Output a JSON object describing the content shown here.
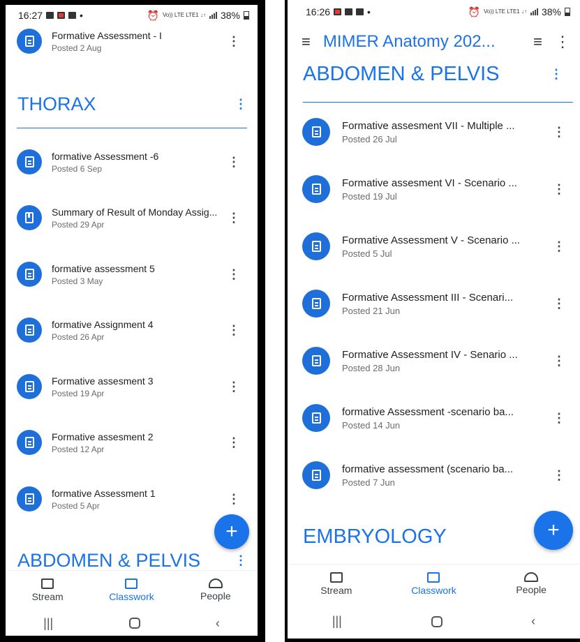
{
  "left_phone": {
    "status": {
      "time": "16:27",
      "battery": "38%",
      "network": "Vo)) LTE LTE1 ↓↑"
    },
    "partial_item": {
      "title": "Formative Assessment - I",
      "posted": "Posted 2 Aug"
    },
    "sections": [
      {
        "title": "THORAX"
      },
      {
        "title": "ABDOMEN & PELVIS"
      }
    ],
    "items": [
      {
        "title": "formative Assessment -6",
        "posted": "Posted 6 Sep",
        "icon": "assignment-icon"
      },
      {
        "title": "Summary of Result of Monday Assig...",
        "posted": "Posted 29 Apr",
        "icon": "material-icon"
      },
      {
        "title": "formative assessment  5",
        "posted": "Posted 3 May",
        "icon": "assignment-icon"
      },
      {
        "title": "formative Assignment 4",
        "posted": "Posted 26 Apr",
        "icon": "assignment-icon"
      },
      {
        "title": "Formative assesment 3",
        "posted": "Posted 19 Apr",
        "icon": "assignment-icon"
      },
      {
        "title": "Formative assesment 2",
        "posted": "Posted 12 Apr",
        "icon": "assignment-icon"
      },
      {
        "title": "formative Assessment 1",
        "posted": "Posted 5 Apr",
        "icon": "assignment-icon"
      }
    ],
    "nav": {
      "stream": "Stream",
      "classwork": "Classwork",
      "people": "People"
    },
    "fab": "+"
  },
  "right_phone": {
    "status": {
      "time": "16:26",
      "battery": "38%",
      "network": "Vo)) LTE LTE1 ↓↑"
    },
    "appbar": {
      "title": "MIMER Anatomy 202..."
    },
    "sections": [
      {
        "title": "ABDOMEN & PELVIS"
      },
      {
        "title": "EMBRYOLOGY"
      }
    ],
    "items": [
      {
        "title": "Formative assesment VII - Multiple ...",
        "posted": "Posted 26 Jul",
        "icon": "assignment-icon"
      },
      {
        "title": "Formative assesment VI - Scenario ...",
        "posted": "Posted 19 Jul",
        "icon": "assignment-icon"
      },
      {
        "title": "Formative Assessment V - Scenario ...",
        "posted": "Posted 5 Jul",
        "icon": "assignment-icon"
      },
      {
        "title": "Formative Assessment III  - Scenari...",
        "posted": "Posted 21 Jun",
        "icon": "assignment-icon"
      },
      {
        "title": "Formative Assessment IV - Senario ...",
        "posted": "Posted 28 Jun",
        "icon": "assignment-icon"
      },
      {
        "title": "formative Assessment -scenario ba...",
        "posted": "Posted 14 Jun",
        "icon": "assignment-icon"
      },
      {
        "title": "formative assessment (scenario ba...",
        "posted": "Posted 7 Jun",
        "icon": "assignment-icon"
      }
    ],
    "nav": {
      "stream": "Stream",
      "classwork": "Classwork",
      "people": "People"
    },
    "fab": "+"
  },
  "colors": {
    "accent": "#1a73e8",
    "avatar": "#1e6fd9",
    "text": "#202124",
    "subtext": "#6b6b6b"
  }
}
